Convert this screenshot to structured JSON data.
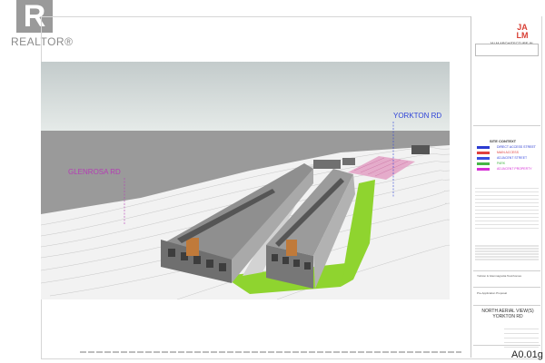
{
  "logo": {
    "mark": "R",
    "text": "REALTOR®"
  },
  "drawing": {
    "street_left": "GLENROSA RD",
    "street_right": "YORKTON RD"
  },
  "title_block": {
    "firm_logo": [
      "JA",
      "LM"
    ],
    "firm_name": "JALM ARCHITECTURE IN",
    "site_context_title": "SITE CONTEXT",
    "legend": [
      {
        "label": "DIRECT ACCESS STREET",
        "color": "#2b3bd1"
      },
      {
        "label": "MAIN ACCESS",
        "color": "#e04040"
      },
      {
        "label": "ADJACENT STREET",
        "color": "#3a4de0"
      },
      {
        "label": "PARK",
        "color": "#46b646"
      },
      {
        "label": "ADJACENT PROPERTY",
        "color": "#d62fd6"
      }
    ],
    "project": "Yorkton & Glenmagnolia Townhomes",
    "applicant": "Pre-Application Proposal",
    "sheet_title": "NORTH AERIAL VIEW(S) YORKTON RD",
    "sheet_number": "A0.01g"
  },
  "colors": {
    "sky_top": "#c9d0d0",
    "sky_bottom": "#e6ebea",
    "grass": "#8fd42f",
    "pink": "#e3a0c4",
    "label_purple": "#b43db4",
    "label_blue": "#2f44d8"
  }
}
